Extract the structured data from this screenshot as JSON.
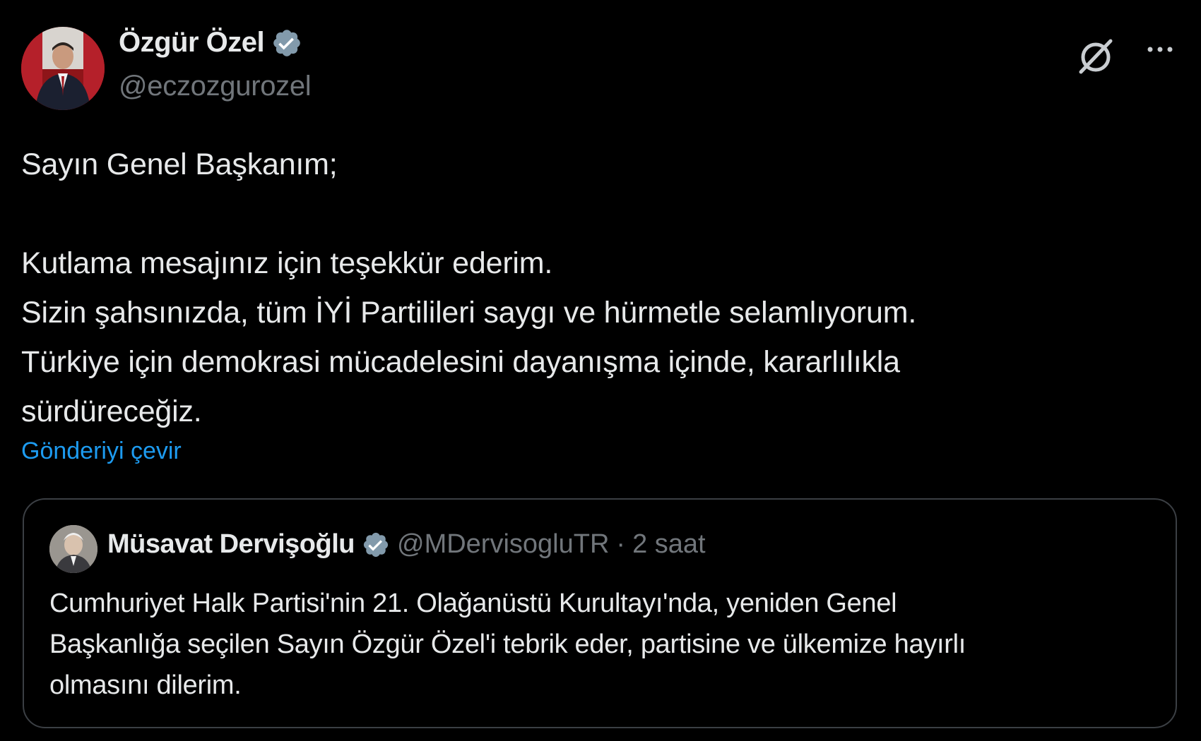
{
  "author": {
    "name": "Özgür Özel",
    "handle": "@eczozgurozel",
    "verified": true
  },
  "icons": {
    "grok": "grok-icon",
    "more": "more-options-icon",
    "verified": "verified-badge-icon"
  },
  "colors": {
    "background": "#000000",
    "text": "#e7e9ea",
    "secondary": "#71767b",
    "link": "#1d9bf0",
    "verified": "#829aab"
  },
  "tweet": {
    "greeting": "Sayın Genel Başkanım;",
    "lines": [
      "Kutlama mesajınız için teşekkür ederim.",
      "Sizin şahsınızda, tüm İYİ Partilileri saygı ve hürmetle selamlıyorum.",
      "Türkiye için demokrasi mücadelesini dayanışma içinde, kararlılıkla",
      "sürdüreceğiz."
    ],
    "translate_link": "Gönderiyi çevir"
  },
  "quote": {
    "name": "Müsavat Dervişoğlu",
    "handle": "@MDervisogluTR",
    "separator": "·",
    "time": "2 saat",
    "verified": true,
    "lines": [
      "Cumhuriyet Halk Partisi'nin 21. Olağanüstü Kurultayı'nda, yeniden Genel",
      "Başkanlığa seçilen Sayın Özgür Özel'i tebrik eder, partisine ve ülkemize hayırlı",
      "olmasını dilerim."
    ]
  }
}
